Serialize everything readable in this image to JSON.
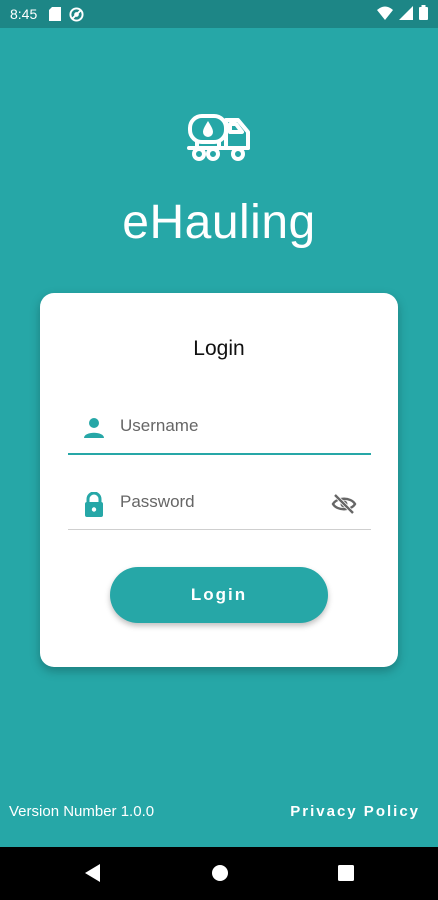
{
  "status_bar": {
    "time": "8:45",
    "left_icons": [
      "sd-card-icon",
      "blocked-icon"
    ],
    "right_icons": [
      "wifi-icon",
      "signal-icon",
      "battery-icon"
    ]
  },
  "app": {
    "title": "eHauling",
    "logo_icon": "tanker-truck-icon"
  },
  "login_card": {
    "title": "Login",
    "username": {
      "placeholder": "Username",
      "value": "",
      "icon": "person-icon"
    },
    "password": {
      "placeholder": "Password",
      "value": "",
      "icon": "lock-icon",
      "toggle_icon": "eye-off-icon"
    },
    "login_button": "Login"
  },
  "footer": {
    "version": "Version Number 1.0.0",
    "privacy": "Privacy Policy"
  },
  "colors": {
    "primary": "#26a7a7",
    "status_bar": "#1d8686",
    "card": "#ffffff",
    "nav_bar": "#000000"
  }
}
